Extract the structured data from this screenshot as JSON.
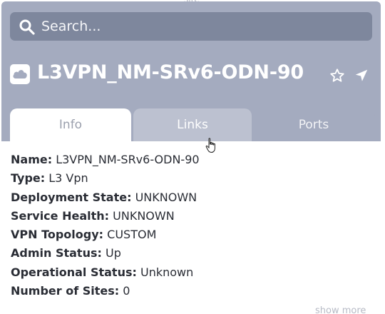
{
  "background": {
    "partial_label": "site"
  },
  "search": {
    "placeholder": "Search..."
  },
  "header": {
    "title": "L3VPN_NM-SRv6-ODN-90"
  },
  "tabs": [
    {
      "label": "Info"
    },
    {
      "label": "Links"
    },
    {
      "label": "Ports"
    }
  ],
  "details": [
    {
      "key": "Name:",
      "value": "L3VPN_NM-SRv6-ODN-90"
    },
    {
      "key": "Type:",
      "value": "L3 Vpn"
    },
    {
      "key": "Deployment State:",
      "value": "UNKNOWN"
    },
    {
      "key": "Service Health:",
      "value": "UNKNOWN"
    },
    {
      "key": "VPN Topology:",
      "value": "CUSTOM"
    },
    {
      "key": "Admin Status:",
      "value": "Up"
    },
    {
      "key": "Operational Status:",
      "value": "Unknown"
    },
    {
      "key": "Number of Sites:",
      "value": "0"
    }
  ],
  "footer": {
    "show_more_label": "show more"
  },
  "colors": {
    "header_bg": "#a4abbf",
    "search_bg": "#7e879d",
    "active_tab_bg": "#ffffff",
    "hover_tab_bg": "#bcc1d0",
    "text_dark": "#2a2d35"
  },
  "icons": {
    "search": "search-icon",
    "service": "cloud-icon",
    "favorite": "star-icon",
    "locate": "location-arrow-icon",
    "pointer": "hand-cursor-icon"
  }
}
